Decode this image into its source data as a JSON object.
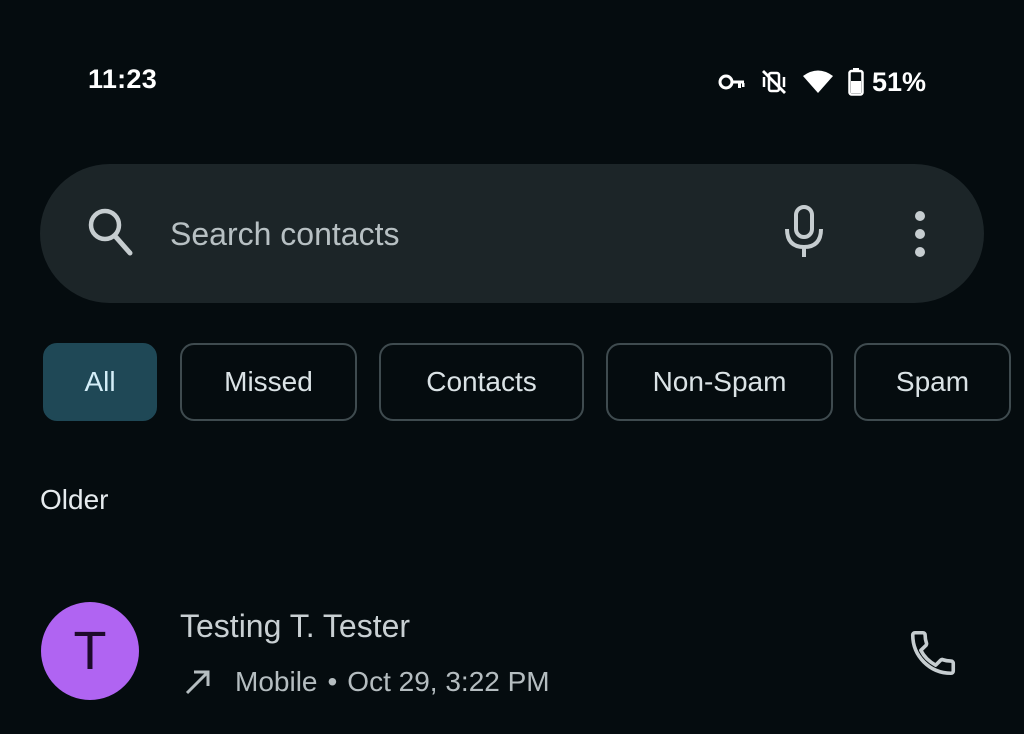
{
  "status_bar": {
    "time": "11:23",
    "battery_percent": "51%",
    "icons": [
      "vpn-key-icon",
      "vibrate-off-icon",
      "wifi-icon",
      "battery-icon"
    ]
  },
  "search": {
    "placeholder": "Search contacts",
    "value": "",
    "icons": [
      "search-icon",
      "mic-icon",
      "more-vert-icon"
    ]
  },
  "filters": {
    "selected": "All",
    "chips": [
      {
        "label": "All"
      },
      {
        "label": "Missed"
      },
      {
        "label": "Contacts"
      },
      {
        "label": "Non-Spam"
      },
      {
        "label": "Spam"
      }
    ]
  },
  "sections": [
    {
      "header": "Older",
      "calls": [
        {
          "avatar_letter": "T",
          "avatar_color": "#b064f2",
          "name": "Testing T. Tester",
          "direction_icon": "outgoing-arrow-icon",
          "type": "Mobile",
          "separator": "•",
          "datetime": "Oct 29, 3:22 PM",
          "action_icon": "phone-icon"
        }
      ]
    }
  ],
  "colors": {
    "background": "#050c0f",
    "search_bar": "#1c2528",
    "chip_selected": "#1f4856",
    "chip_border": "#3f4b4f"
  }
}
